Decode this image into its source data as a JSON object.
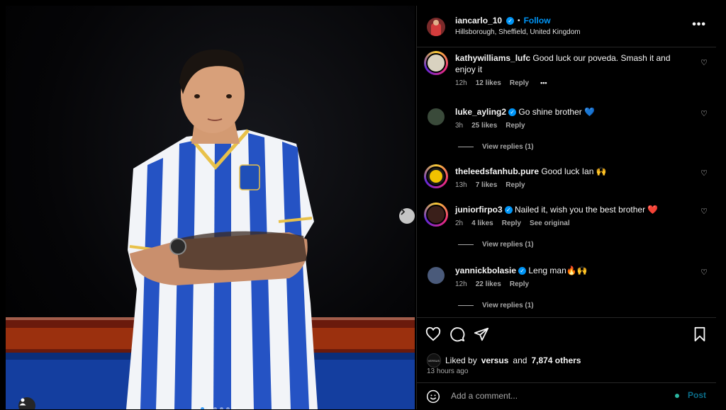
{
  "post": {
    "author": "iancarlo_10",
    "follow_label": "Follow",
    "location": "Hillsborough, Sheffield, United Kingdom",
    "more_label": "•••",
    "image": {
      "total_slides": 6,
      "current_slide": 1
    }
  },
  "comments": [
    {
      "username": "kathywilliams_lufc",
      "verified": false,
      "text": "Good luck our poveda. Smash it and enjoy it",
      "time": "12h",
      "likes": "12 likes",
      "reply": "Reply",
      "extra": "•••",
      "view_replies": ""
    },
    {
      "username": "luke_ayling2",
      "verified": true,
      "text": "Go shine brother 💙",
      "time": "3h",
      "likes": "25 likes",
      "reply": "Reply",
      "extra": "",
      "view_replies": "View replies (1)"
    },
    {
      "username": "theleedsfanhub.pure",
      "verified": false,
      "text": "Good luck Ian 🙌",
      "time": "13h",
      "likes": "7 likes",
      "reply": "Reply",
      "extra": "",
      "view_replies": ""
    },
    {
      "username": "juniorfirpo3",
      "verified": true,
      "text": "Nailed it, wish you the best brother ❤️",
      "time": "2h",
      "likes": "4 likes",
      "reply": "Reply",
      "extra": "See original",
      "view_replies": "View replies (1)"
    },
    {
      "username": "yannickbolasie",
      "verified": true,
      "text": "Leng man🔥🙌",
      "time": "12h",
      "likes": "22 likes",
      "reply": "Reply",
      "extra": "",
      "view_replies": "View replies (1)"
    }
  ],
  "likes": {
    "prefix": "Liked by",
    "user": "versus",
    "connector": "and",
    "others": "7,874 others",
    "avatar_text": "VERSUS"
  },
  "timestamp": "13 hours ago",
  "add_comment": {
    "placeholder": "Add a comment...",
    "post_label": "Post"
  },
  "colors": {
    "accent": "#0095f6",
    "post": "#0b6e8a"
  }
}
